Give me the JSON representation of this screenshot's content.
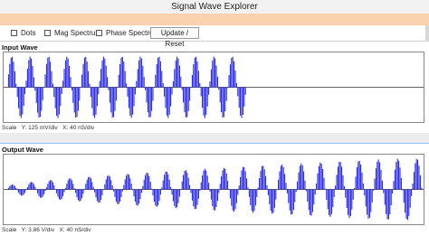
{
  "window": {
    "title": "Signal Wave Explorer"
  },
  "toolbar": {
    "dots_label": "Dots",
    "mag_label": "Mag Spectrum",
    "phase_label": "Phase Spectrum",
    "update_label": "Update / Reset"
  },
  "input_panel": {
    "title": "Input Wave",
    "scale_label": "Scale",
    "y_scale": "Y: 125 mV/div",
    "x_scale": "X: 40 nS/div"
  },
  "output_panel": {
    "title": "Output Wave",
    "scale_label": "Scale",
    "y_scale": "Y: 3.86 V/div",
    "x_scale": "X: 40 nS/div"
  },
  "colors": {
    "wave": "#1a1ae6",
    "accent_bar": "#fbd2b0",
    "output_border": "#8ec0ff"
  }
}
